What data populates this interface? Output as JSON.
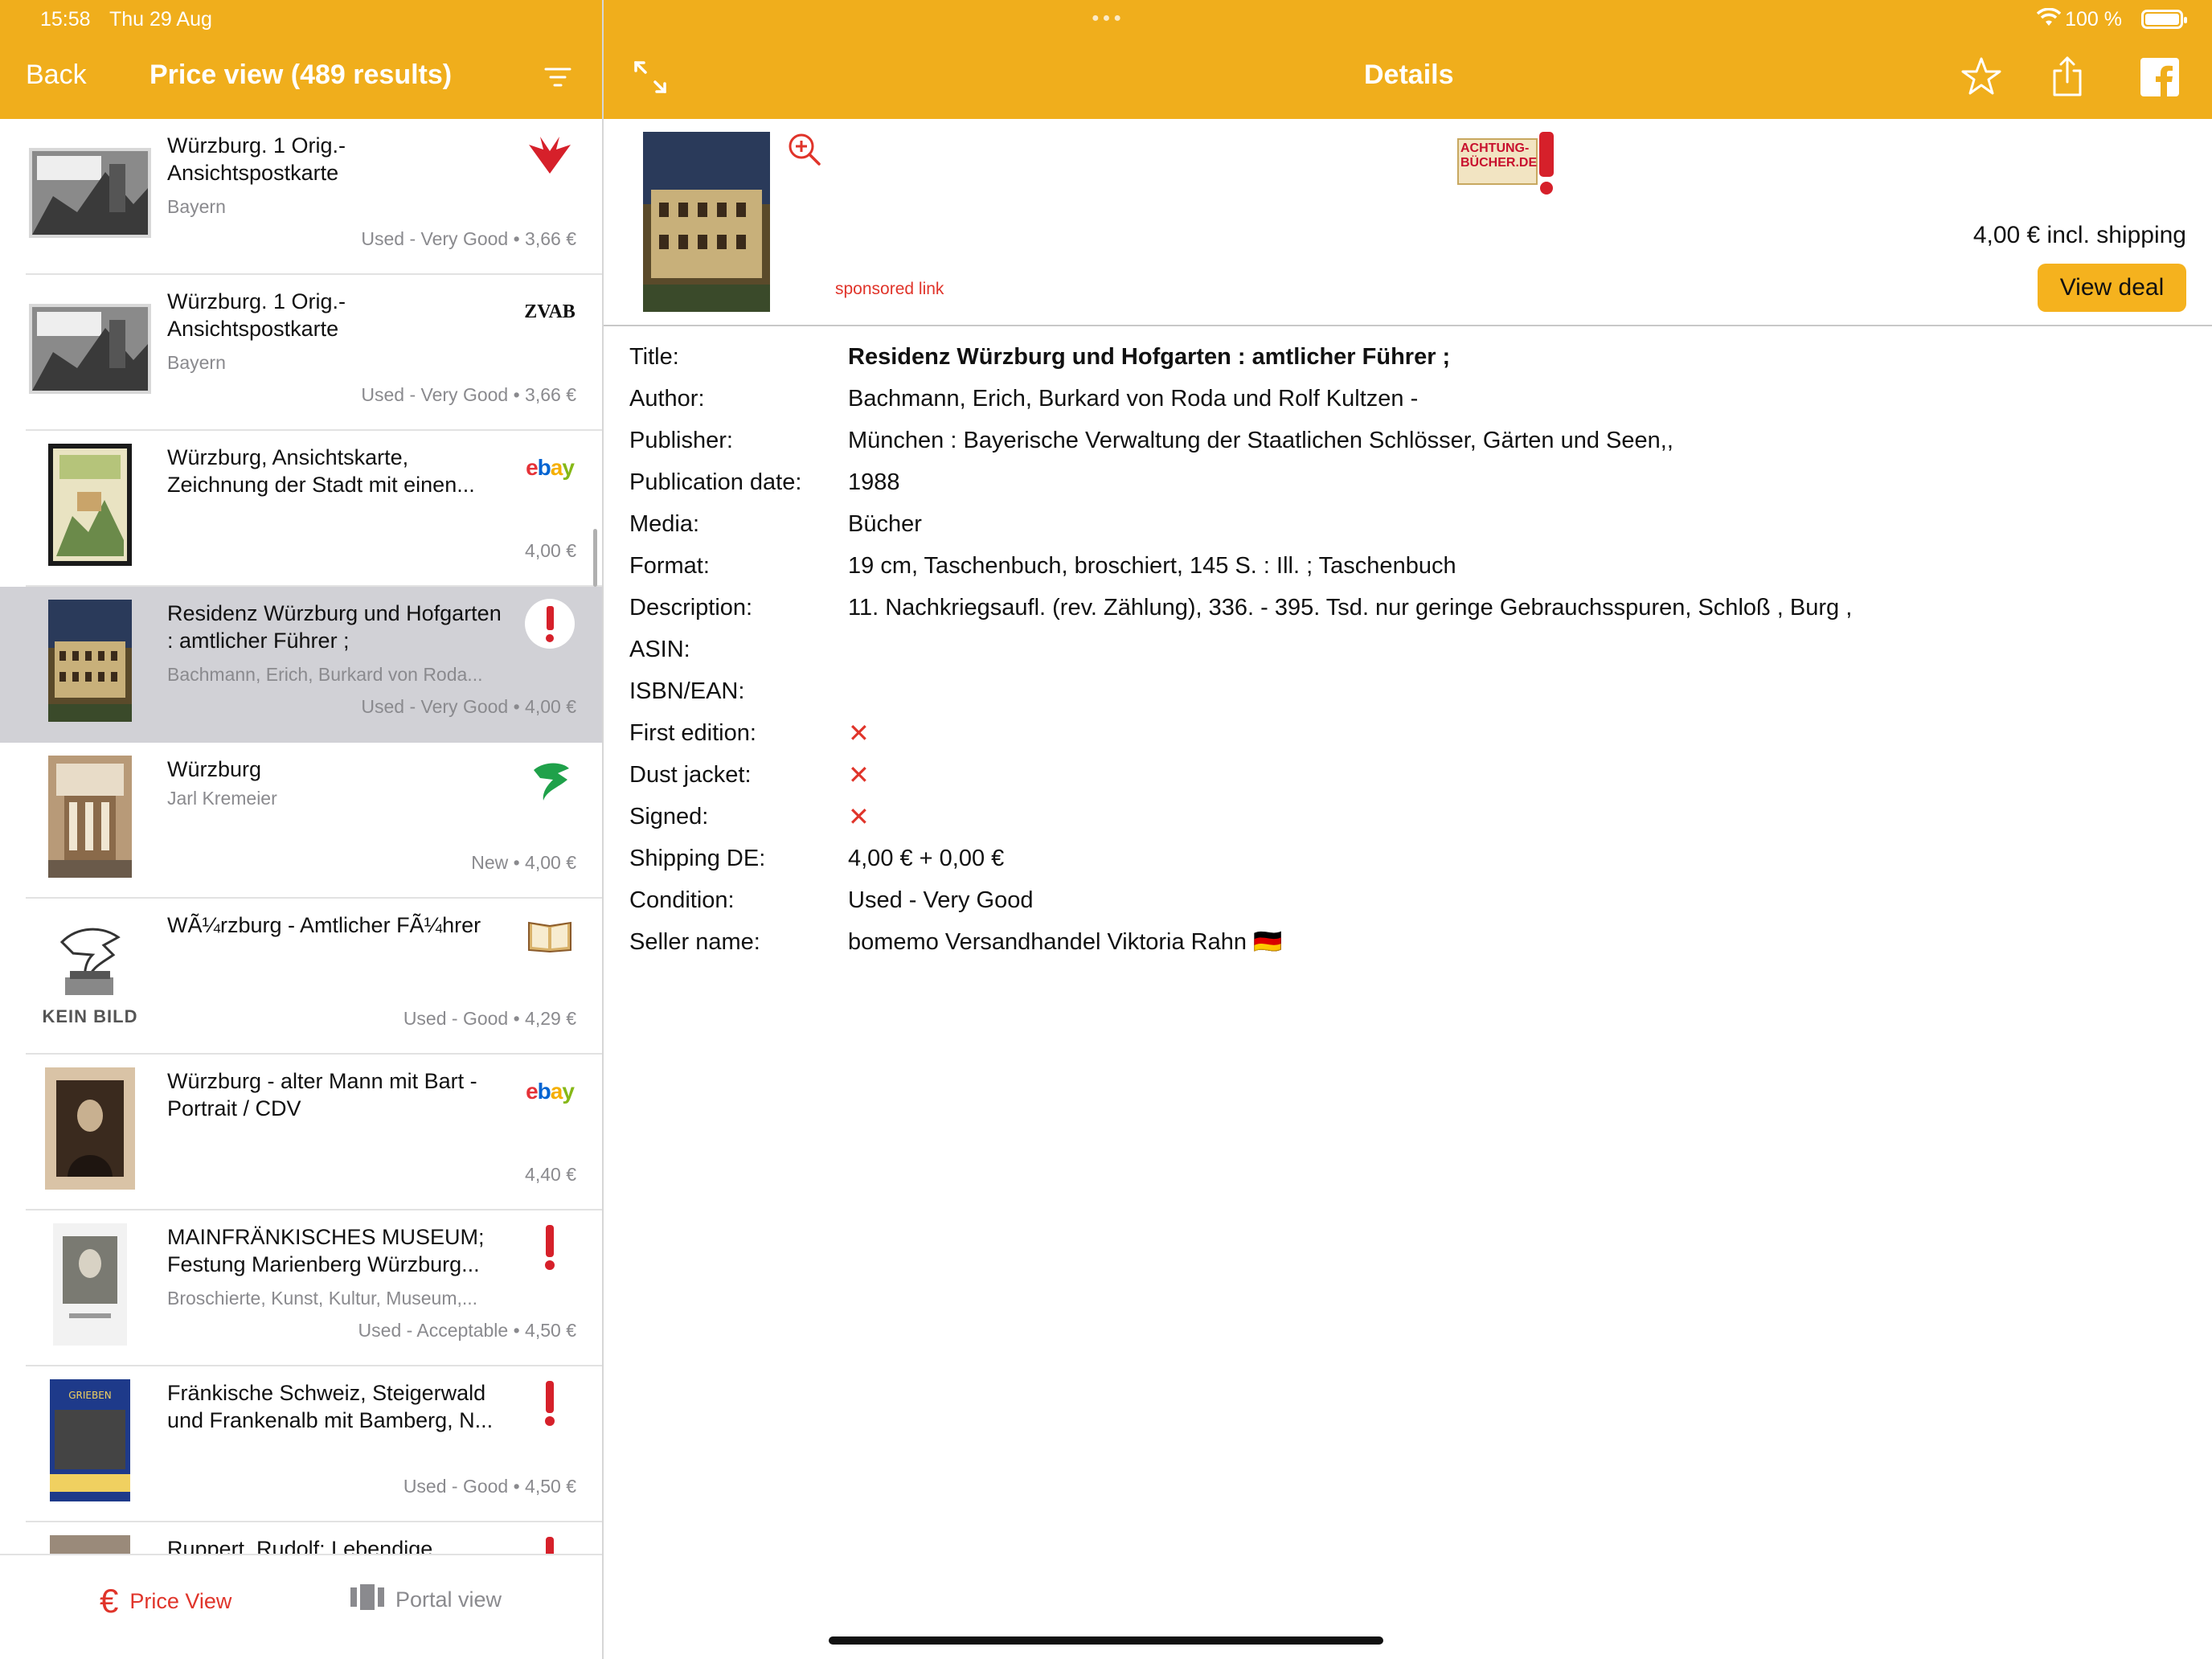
{
  "status_bar": {
    "time": "15:58",
    "date": "Thu 29 Aug",
    "battery": "100 %"
  },
  "left_nav": {
    "back": "Back",
    "title": "Price view (489 results)"
  },
  "right_nav": {
    "title": "Details"
  },
  "icons": [
    "filter-icon",
    "expand-icon",
    "star-icon",
    "share-icon",
    "facebook-icon",
    "zoom-in-icon",
    "euro-icon",
    "portal-icon"
  ],
  "results": [
    {
      "title": "Würzburg. 1 Orig.- Ansichtspostkarte",
      "subtitle": "Bayern",
      "condition": "Used - Very Good • 3,66 €",
      "logo": "booklooker-logo"
    },
    {
      "title": "Würzburg. 1 Orig.- Ansichtspostkarte",
      "subtitle": "Bayern",
      "condition": "Used - Very Good • 3,66 €",
      "logo": "ZVAB"
    },
    {
      "title": "Würzburg, Ansichtskarte, Zeichnung der Stadt mit einen...",
      "subtitle": "",
      "condition": "4,00 €",
      "logo": "ebay"
    },
    {
      "title": "Residenz Würzburg und Hofgarten : amtlicher Führer ;",
      "subtitle": "Bachmann, Erich, Burkard von Roda...",
      "condition": "Used - Very Good • 4,00 €",
      "logo": "achtung-buecher-logo",
      "selected": true
    },
    {
      "title": "Würzburg",
      "subtitle": "Jarl Kremeier",
      "condition": "New • 4,00 €",
      "logo": "medimops-logo"
    },
    {
      "title": "WÃ¼rzburg - Amtlicher FÃ¼hrer",
      "subtitle": "",
      "condition": "Used - Good • 4,29 €",
      "logo": "book-logo",
      "thumb_text": "KEIN BILD"
    },
    {
      "title": "Würzburg - alter Mann mit Bart - Portrait / CDV",
      "subtitle": "",
      "condition": "4,40 €",
      "logo": "ebay"
    },
    {
      "title": "MAINFRÄNKISCHES MUSEUM; Festung Marienberg Würzburg...",
      "subtitle": "Broschierte, Kunst, Kultur, Museum,...",
      "condition": "Used - Acceptable • 4,50 €",
      "logo": "achtung-buecher-logo"
    },
    {
      "title": "Fränkische Schweiz, Steigerwald und Frankenalb mit Bamberg, N...",
      "subtitle": "",
      "condition": "Used - Good • 4,50 €",
      "logo": "achtung-buecher-logo"
    },
    {
      "title": "Ruppert, Rudolf: Lebendige",
      "subtitle": "",
      "condition": "",
      "logo": "achtung-buecher-logo"
    }
  ],
  "tabbar": {
    "price_view": "Price View",
    "portal_view": "Portal view"
  },
  "deal": {
    "shop_logo_text": "ACHTUNG-BÜCHER.DE",
    "sponsored": "sponsored link",
    "price": "4,00 € incl. shipping",
    "view_deal": "View deal"
  },
  "details": [
    {
      "label": "Title:",
      "value": "Residenz Würzburg und Hofgarten : amtlicher Führer ;",
      "bold": true
    },
    {
      "label": "Author:",
      "value": "Bachmann, Erich, Burkard von Roda  und Rolf Kultzen -"
    },
    {
      "label": "Publisher:",
      "value": "München : Bayerische Verwaltung der Staatlichen Schlösser, Gärten und Seen,,"
    },
    {
      "label": "Publication date:",
      "value": "1988"
    },
    {
      "label": "Media:",
      "value": "Bücher"
    },
    {
      "label": "Format:",
      "value": "19 cm, Taschenbuch, broschiert,  145 S. : Ill. ; Taschenbuch"
    },
    {
      "label": "Description:",
      "value": "11. Nachkriegsaufl. (rev. Zählung), 336. - 395. Tsd. nur geringe Gebrauchsspuren, Schloß , Burg ,"
    },
    {
      "label": "ASIN:",
      "value": ""
    },
    {
      "label": "ISBN/EAN:",
      "value": ""
    },
    {
      "label": "First edition:",
      "value": "✕",
      "mark": true
    },
    {
      "label": "Dust jacket:",
      "value": "✕",
      "mark": true
    },
    {
      "label": "Signed:",
      "value": "✕",
      "mark": true
    },
    {
      "label": "Shipping DE:",
      "value": "4,00 € + 0,00 €"
    },
    {
      "label": "Condition:",
      "value": "Used - Very Good"
    },
    {
      "label": "Seller name:",
      "value": "bomemo Versandhandel Viktoria Rahn 🇩🇪"
    }
  ],
  "colors": {
    "accent": "#F0AE1C",
    "red": "#E0342A",
    "selected_row": "#D1D1D6",
    "view_deal": "#F5B21E"
  }
}
